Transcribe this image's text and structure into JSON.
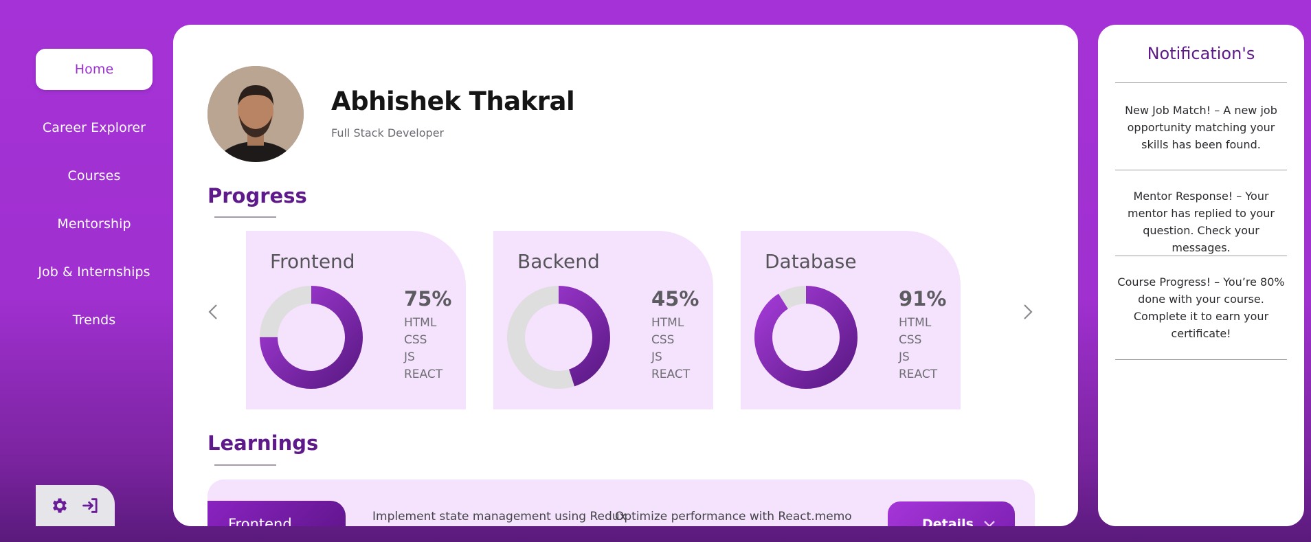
{
  "sidebar": {
    "items": [
      {
        "label": "Home",
        "active": true
      },
      {
        "label": "Career Explorer"
      },
      {
        "label": "Courses"
      },
      {
        "label": "Mentorship"
      },
      {
        "label": "Job & Internships"
      },
      {
        "label": "Trends"
      }
    ],
    "tools": [
      "gear-icon",
      "logout-icon"
    ]
  },
  "profile": {
    "name": "Abhishek Thakral",
    "role": "Full Stack Developer"
  },
  "progress": {
    "title": "Progress",
    "cards": [
      {
        "title": "Frontend",
        "percent": "75%",
        "value": 0.75,
        "skills": [
          "HTML",
          "CSS",
          "JS",
          "REACT"
        ]
      },
      {
        "title": "Backend",
        "percent": "45%",
        "value": 0.45,
        "skills": [
          "HTML",
          "CSS",
          "JS",
          "REACT"
        ]
      },
      {
        "title": "Database",
        "percent": "91%",
        "value": 0.91,
        "skills": [
          "HTML",
          "CSS",
          "JS",
          "REACT"
        ]
      }
    ]
  },
  "learnings": {
    "title": "Learnings",
    "tab_label": "Frontend",
    "items": [
      "Implement state management using Redux",
      "Optimize performance with React.memo"
    ],
    "details_label": "Details"
  },
  "notifications": {
    "title": "Notification's",
    "items": [
      "New Job Match! – A new job opportunity matching your skills has been found.",
      "Mentor Response! – Your mentor has replied to your question. Check your messages.",
      "Course Progress! – You’re 80% done with your course. Complete it to earn your certificate!"
    ]
  },
  "colors": {
    "brand_purple": "#a532d6",
    "dark_purple": "#5e1a8a",
    "card_bg": "#f5e2fd",
    "ring_empty": "#dedede"
  }
}
